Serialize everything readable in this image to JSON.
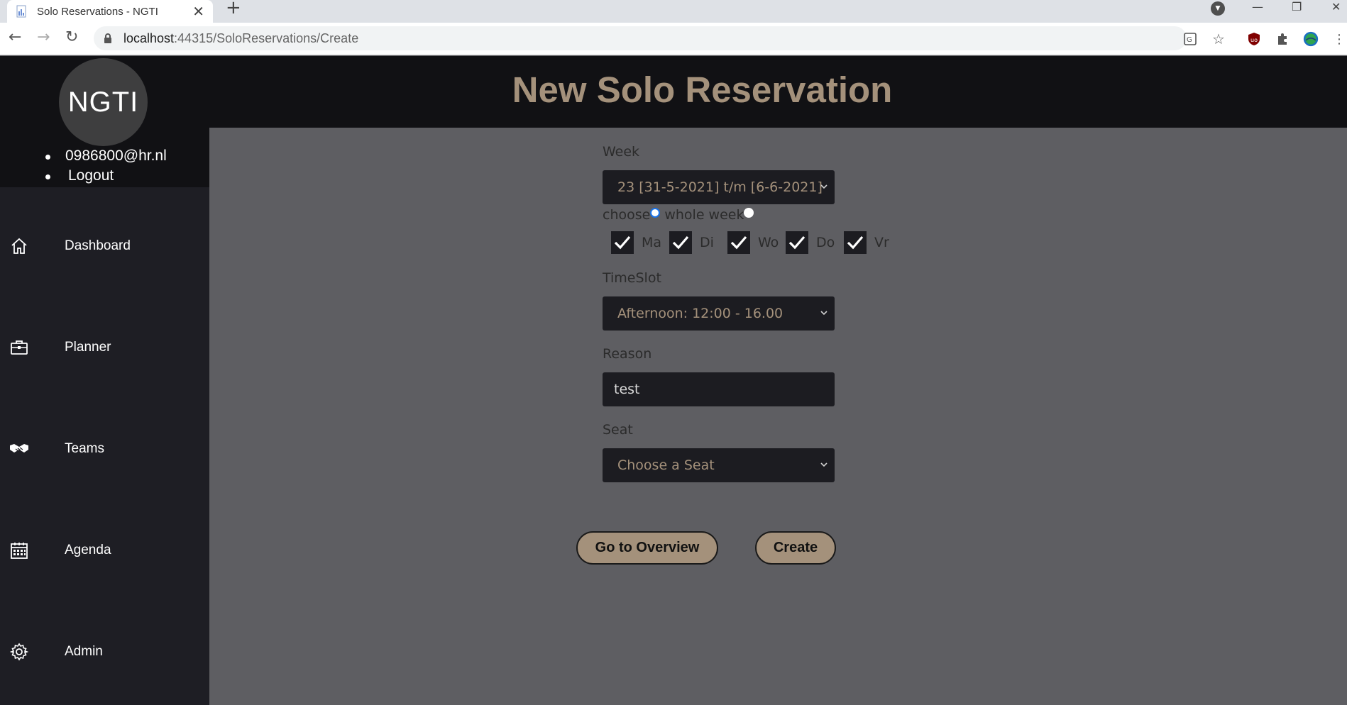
{
  "browser": {
    "tab_title": "Solo Reservations - NGTI",
    "tab_close": "✕",
    "new_tab": "+",
    "url_host": "localhost",
    "url_rest": ":44315/SoloReservations/Create",
    "window_min": "—",
    "window_restore": "❐",
    "window_close": "✕"
  },
  "sidebar": {
    "logo_text": "NGTI",
    "user_email": "0986800@hr.nl",
    "logout_label": "Logout",
    "items": [
      {
        "label": "Dashboard",
        "icon": "home-icon"
      },
      {
        "label": "Planner",
        "icon": "briefcase-icon"
      },
      {
        "label": "Teams",
        "icon": "handshake-icon"
      },
      {
        "label": "Agenda",
        "icon": "calendar-icon"
      },
      {
        "label": "Admin",
        "icon": "gear-icon"
      }
    ]
  },
  "header": {
    "title": "New Solo Reservation"
  },
  "form": {
    "week_label": "Week",
    "week_value": "23 [31-5-2021] t/m [6-6-2021]",
    "radio_choose_label": "choose",
    "radio_whole_week_label": "whole week",
    "selected_mode": "choose",
    "days": [
      {
        "label": "Ma",
        "checked": true
      },
      {
        "label": "Di",
        "checked": true
      },
      {
        "label": "Wo",
        "checked": true
      },
      {
        "label": "Do",
        "checked": true
      },
      {
        "label": "Vr",
        "checked": true
      }
    ],
    "timeslot_label": "TimeSlot",
    "timeslot_value": "Afternoon: 12:00 - 16.00",
    "reason_label": "Reason",
    "reason_value": "test",
    "seat_label": "Seat",
    "seat_placeholder": "Choose a Seat"
  },
  "actions": {
    "overview_label": "Go to Overview",
    "create_label": "Create"
  },
  "colors": {
    "accent": "#a4917b",
    "sidebar_bg": "#1e1e24",
    "header_bg": "#111114",
    "content_bg": "#5e5e62",
    "control_bg": "#1c1c21"
  }
}
